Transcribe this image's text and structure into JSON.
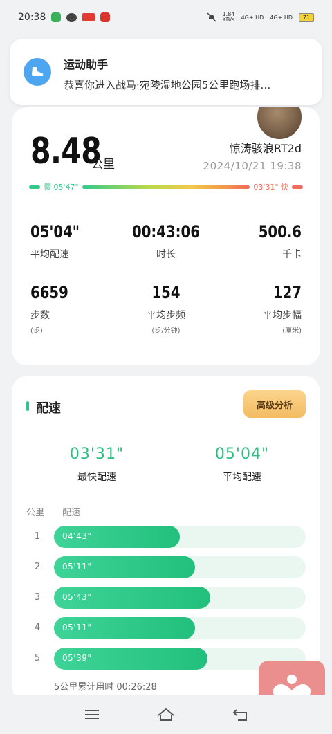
{
  "status_bar": {
    "time": "20:38",
    "net_speed": "1.84 KB/s",
    "sim1": "4G+ HD",
    "sim2": "4G+ HD",
    "battery": "71"
  },
  "notification": {
    "app_name": "运动助手",
    "message": "恭喜你进入战马·宛陵湿地公园5公里跑场排…"
  },
  "summary_card": {
    "distance": "8.48",
    "distance_unit": "公里",
    "username": "惊涛骇浪RT2d",
    "datetime": "2024/10/21 19:38",
    "slow_label": "慢 05'47\"",
    "fast_label": "03'31\" 快",
    "stats": [
      {
        "value": "05'04\"",
        "label": "平均配速",
        "sub": ""
      },
      {
        "value": "00:43:06",
        "label": "时长",
        "sub": ""
      },
      {
        "value": "500.6",
        "label": "千卡",
        "sub": ""
      },
      {
        "value": "6659",
        "label": "步数",
        "sub": "(步)"
      },
      {
        "value": "154",
        "label": "平均步频",
        "sub": "(步/分钟)"
      },
      {
        "value": "127",
        "label": "平均步幅",
        "sub": "(厘米)"
      }
    ]
  },
  "pace_card": {
    "title": "配速",
    "advanced_button": "高级分析",
    "fastest_value": "03'31\"",
    "fastest_label": "最快配速",
    "average_value": "05'04\"",
    "average_label": "平均配速",
    "col_km": "公里",
    "col_pace": "配速",
    "rows": [
      {
        "km": "1",
        "pace": "04'43\"",
        "fill": 0.5
      },
      {
        "km": "2",
        "pace": "05'11\"",
        "fill": 0.56
      },
      {
        "km": "3",
        "pace": "05'43\"",
        "fill": 0.62
      },
      {
        "km": "4",
        "pace": "05'11\"",
        "fill": 0.56
      },
      {
        "km": "5",
        "pace": "05'39\"",
        "fill": 0.61
      }
    ],
    "total_time": "5公里累计用时 00:26:28"
  },
  "colors": {
    "accent_green": "#2cbf7f",
    "notif_icon": "#4fa6f0",
    "button_gold": "#f3bb63",
    "float_app": "#eb8e8e"
  },
  "icons": {
    "notification": "running-shoe-icon",
    "nav_menu": "menu-icon",
    "nav_home": "home-icon",
    "nav_back": "back-icon",
    "float_app": "health-heart-icon"
  }
}
